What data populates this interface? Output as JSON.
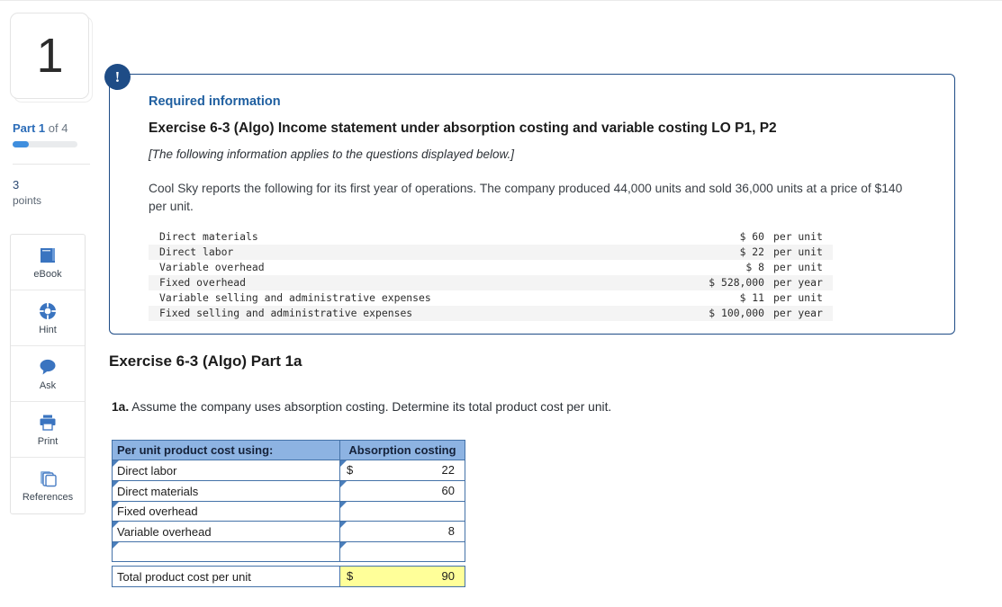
{
  "sidebar": {
    "question_number": "1",
    "part_label_prefix": "Part 1",
    "part_label_suffix": " of 4",
    "progress_percent": 25,
    "points_value": "3",
    "points_word": "points",
    "tools": [
      {
        "name": "ebook",
        "label": "eBook",
        "icon": "book-icon"
      },
      {
        "name": "hint",
        "label": "Hint",
        "icon": "lifebuoy-icon"
      },
      {
        "name": "ask",
        "label": "Ask",
        "icon": "chat-bubble-icon"
      },
      {
        "name": "print",
        "label": "Print",
        "icon": "printer-icon"
      },
      {
        "name": "references",
        "label": "References",
        "icon": "copy-pages-icon"
      }
    ]
  },
  "info_panel": {
    "badge": "!",
    "required_information": "Required information",
    "exercise_title": "Exercise 6-3 (Algo) Income statement under absorption costing and variable costing LO P1, P2",
    "applies_note": "[The following information applies to the questions displayed below.]",
    "intro": "Cool Sky reports the following for its first year of operations. The company produced 44,000 units and sold 36,000 units at a price of $140 per unit.",
    "cost_rows": [
      {
        "label": "Direct materials",
        "amount": "$ 60",
        "period": "per unit"
      },
      {
        "label": "Direct labor",
        "amount": "$ 22",
        "period": "per unit"
      },
      {
        "label": "Variable overhead",
        "amount": "$ 8",
        "period": "per unit"
      },
      {
        "label": "Fixed overhead",
        "amount": "$ 528,000",
        "period": "per year"
      },
      {
        "label": "Variable selling and administrative expenses",
        "amount": "$ 11",
        "period": "per unit"
      },
      {
        "label": "Fixed selling and administrative expenses",
        "amount": "$ 100,000",
        "period": "per year"
      }
    ]
  },
  "part_section": {
    "heading": "Exercise 6-3 (Algo) Part 1a",
    "question_number": "1a.",
    "question_text": " Assume the company uses absorption costing. Determine its total product cost per unit."
  },
  "answer_table": {
    "header_left": "Per unit product cost using:",
    "header_right": "Absorption costing",
    "rows": [
      {
        "label": "Direct labor",
        "dollar": "$",
        "value": "22"
      },
      {
        "label": "Direct materials",
        "dollar": "",
        "value": "60"
      },
      {
        "label": "Fixed overhead",
        "dollar": "",
        "value": ""
      },
      {
        "label": "Variable overhead",
        "dollar": "",
        "value": "8"
      },
      {
        "label": "",
        "dollar": "",
        "value": ""
      }
    ],
    "total_label": "Total product cost per unit",
    "total_dollar": "$",
    "total_value": "90"
  },
  "colors": {
    "panel_border": "#1e4c86",
    "badge": "#1e4c86",
    "link_blue": "#1f5fa0",
    "table_header_blue": "#8db3e2",
    "table_border_blue": "#4472a8",
    "total_highlight_yellow": "#ffff99",
    "progress_blue": "#3f8ede"
  }
}
